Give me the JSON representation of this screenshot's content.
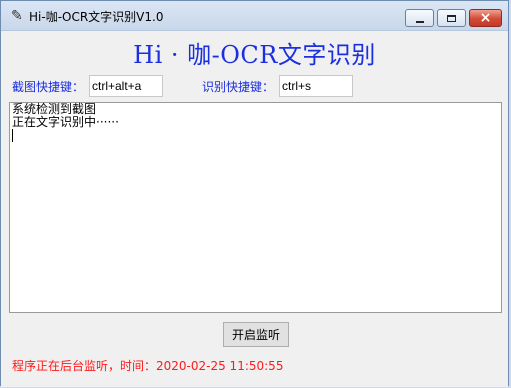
{
  "window": {
    "title": "Hi-咖-OCR文字识别V1.0",
    "controls": {
      "minimize": "minimize",
      "maximize": "maximize",
      "close": "close"
    }
  },
  "app_title": "Hi · 咖-OCR文字识别",
  "hotkeys": {
    "screenshot_label": "截图快捷键：",
    "screenshot_value": "ctrl+alt+a",
    "ocr_label": "识别快捷键：",
    "ocr_value": "ctrl+s"
  },
  "log": {
    "lines": [
      "系统检测到截图",
      "正在文字识别中······"
    ]
  },
  "start_button": "开启监听",
  "status": "程序正在后台监听，时间：2020-02-25 11:50:55",
  "colors": {
    "accent": "#1c2fe0",
    "status": "#ff1a1a",
    "close_button": "#c63a27"
  },
  "icons": {
    "app": "feather-icon",
    "minimize": "minimize-icon",
    "maximize": "maximize-icon",
    "close": "close-icon"
  }
}
